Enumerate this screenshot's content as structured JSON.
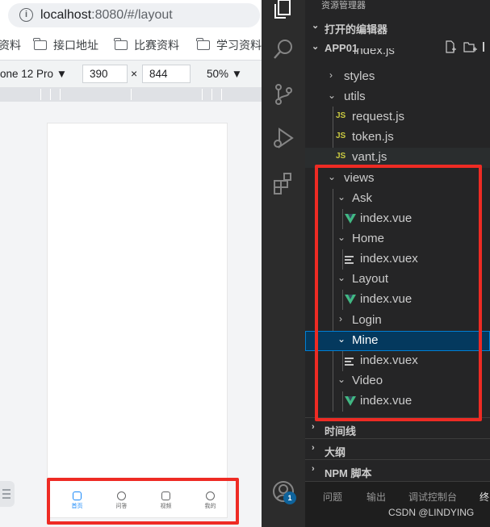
{
  "browser": {
    "url_host": "localhost",
    "url_rest": ":8080/#/layout",
    "bookmarks": [
      "资料",
      "接口地址",
      "比赛资料",
      "学习资料"
    ],
    "device": "one 12 Pro ▼",
    "width": "390",
    "times": "×",
    "height": "844",
    "zoom": "50% ▼",
    "tabs": [
      "首页",
      "问答",
      "视频",
      "我的"
    ]
  },
  "vscode": {
    "header_title": "资源管理器",
    "open_editors": "打开的编辑器",
    "project": "APP01",
    "tree": {
      "index_js_partial": "index.js",
      "styles": "styles",
      "utils": "utils",
      "request": "request.js",
      "token": "token.js",
      "vant": "vant.js",
      "views": "views",
      "ask": "Ask",
      "ask_index": "index.vue",
      "home": "Home",
      "home_index": "index.vuex",
      "layout": "Layout",
      "layout_index": "index.vue",
      "login": "Login",
      "mine": "Mine",
      "mine_index": "index.vuex",
      "video": "Video",
      "video_index": "index.vue"
    },
    "sections": [
      "时间线",
      "大纲",
      "NPM 脚本"
    ],
    "panel_tabs": [
      "问题",
      "输出",
      "调试控制台",
      "终"
    ],
    "badge": "1",
    "js_label": "JS"
  },
  "watermark": "CSDN @LINDYING",
  "colors": {
    "highlight_red": "#ee2b24",
    "vue_green": "#41b883",
    "selection_blue": "#04395e",
    "active_tab": "#1989fa"
  }
}
